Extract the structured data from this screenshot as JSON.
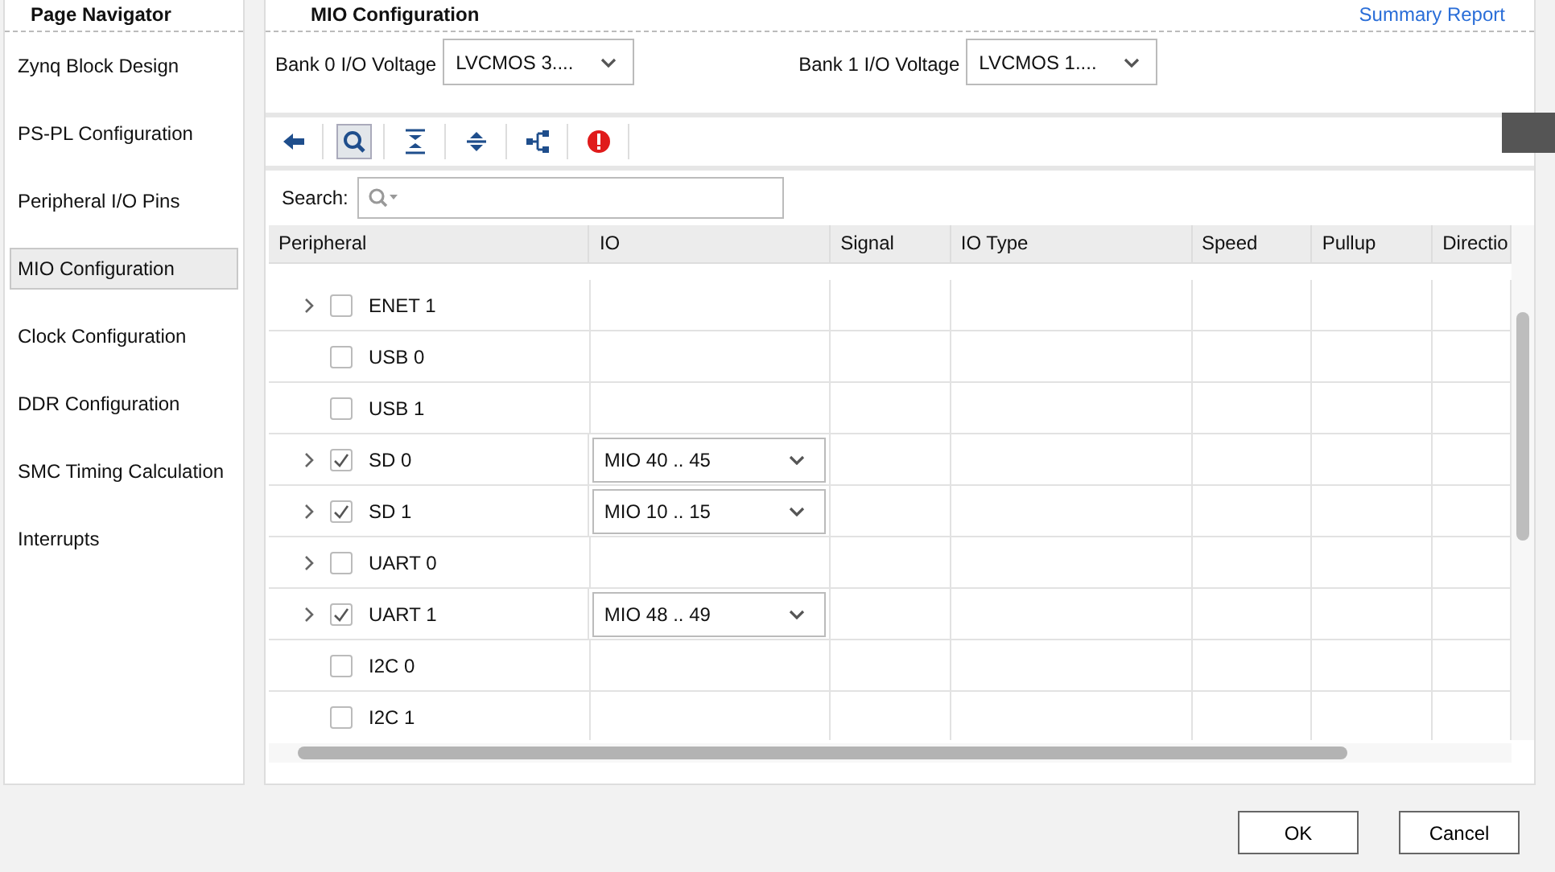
{
  "navigator": {
    "title": "Page Navigator",
    "items": [
      {
        "label": "Zynq Block Design",
        "selected": false
      },
      {
        "label": "PS-PL Configuration",
        "selected": false
      },
      {
        "label": "Peripheral I/O Pins",
        "selected": false
      },
      {
        "label": "MIO Configuration",
        "selected": true
      },
      {
        "label": "Clock Configuration",
        "selected": false
      },
      {
        "label": "DDR Configuration",
        "selected": false
      },
      {
        "label": "SMC Timing Calculation",
        "selected": false
      },
      {
        "label": "Interrupts",
        "selected": false
      }
    ]
  },
  "page": {
    "title": "MIO Configuration",
    "summary_link": "Summary Report"
  },
  "voltages": [
    {
      "label": "Bank 0 I/O Voltage",
      "value": "LVCMOS 3...."
    },
    {
      "label": "Bank 1 I/O Voltage",
      "value": "LVCMOS 1...."
    }
  ],
  "search": {
    "label": "Search:"
  },
  "table": {
    "columns": [
      "Peripheral",
      "IO",
      "Signal",
      "IO Type",
      "Speed",
      "Pullup",
      "Directio"
    ],
    "rows": [
      {
        "name": "ENET 1",
        "expandable": true,
        "checked": false
      },
      {
        "name": "USB 0",
        "expandable": false,
        "checked": false
      },
      {
        "name": "USB 1",
        "expandable": false,
        "checked": false
      },
      {
        "name": "SD 0",
        "expandable": true,
        "checked": true,
        "io": "MIO 40 .. 45"
      },
      {
        "name": "SD 1",
        "expandable": true,
        "checked": true,
        "io": "MIO 10 .. 15"
      },
      {
        "name": "UART 0",
        "expandable": true,
        "checked": false
      },
      {
        "name": "UART 1",
        "expandable": true,
        "checked": true,
        "io": "MIO 48 .. 49"
      },
      {
        "name": "I2C 0",
        "expandable": false,
        "checked": false
      },
      {
        "name": "I2C 1",
        "expandable": false,
        "checked": false
      }
    ]
  },
  "buttons": [
    "OK",
    "Cancel"
  ]
}
